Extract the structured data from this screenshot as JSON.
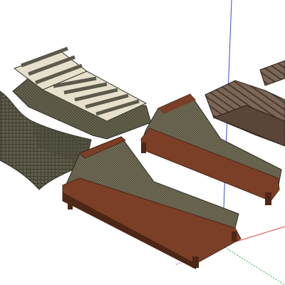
{
  "viewport": {
    "background": "#ffffff",
    "axis_colors": {
      "red": "#d9473f",
      "green": "#2fa84a",
      "blue": "#3c49d8"
    }
  },
  "models": [
    {
      "name": "striped-cushion-rattan-lounger",
      "colors": {
        "rattan": "#5e5a48",
        "cushion_light": "#e8e2cf",
        "cushion_stripe": "#5c5a4d"
      }
    },
    {
      "name": "curved-wicker-chaise",
      "colors": {
        "weave": "#595746",
        "weave_dark": "#3f3d31"
      }
    },
    {
      "name": "wood-frame-lounger-front",
      "colors": {
        "wood": "#7a3f26",
        "wood_dark": "#4d2616",
        "mat": "#6e6a50"
      }
    },
    {
      "name": "wood-frame-lounger-middle",
      "colors": {
        "wood": "#7a3f26",
        "wood_dark": "#4d2616",
        "mat": "#77725a"
      }
    },
    {
      "name": "slatted-teak-lounger",
      "colors": {
        "slat": "#7c6657",
        "slat_dark": "#4b3a30"
      }
    }
  ]
}
